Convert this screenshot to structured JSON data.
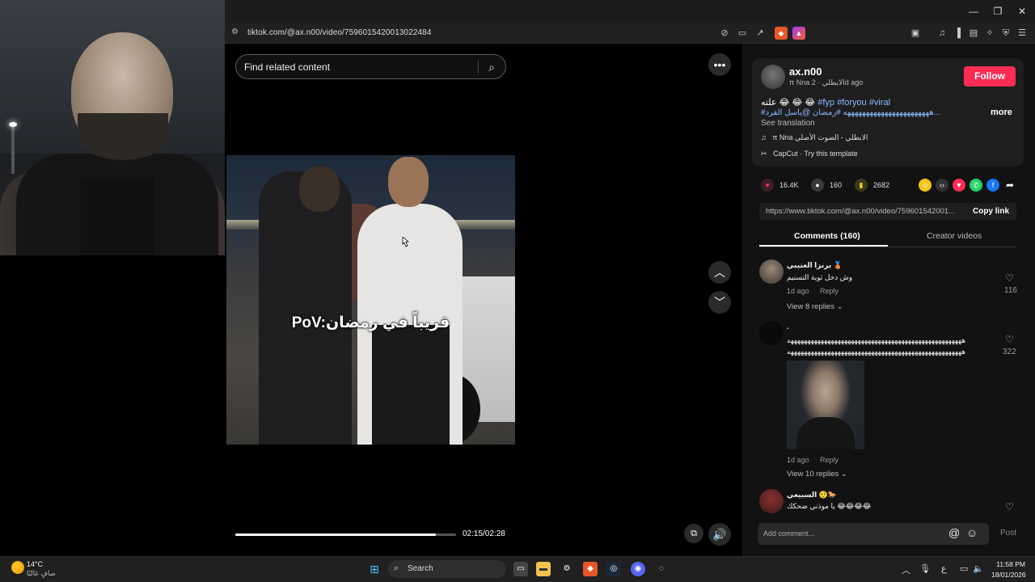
{
  "window": {
    "minimize": "—",
    "maximize": "❐",
    "close": "✕"
  },
  "address": {
    "url": "tiktok.com/@ax.n00/video/7596015420013022484"
  },
  "video": {
    "search_placeholder": "Find related content",
    "caption": "PoV:قريباً في رمضان",
    "time": "02:15/02:28",
    "progress_fraction": 0.91
  },
  "author": {
    "username": "ax.n00",
    "subtitle": "π Nna الابطلي · 2d ago",
    "follow_label": "Follow"
  },
  "description": {
    "prefix": "علته 😂 😂 😂",
    "tags": "#fyp #foryou #viral",
    "line2": "#هههههههههههههههههههههههه #رمضان @ياسل الفرد...",
    "more": "more",
    "see_translation": "See translation",
    "music": "π Nna الابطلي - الصوت الأصلي",
    "capcut": "CapCut · Try this template"
  },
  "stats": {
    "likes": "16.4K",
    "comments": "160",
    "saves": "2682"
  },
  "share": {
    "link": "https://www.tiktok.com/@ax.n00/video/759601542001...",
    "copy_label": "Copy link"
  },
  "tabs": {
    "comments": "Comments (160)",
    "creator": "Creator videos"
  },
  "comments": [
    {
      "name": "برنزا العتيبي 🥉",
      "text": "وش دخل ثوية التسنيم",
      "time": "1d ago",
      "reply": "Reply",
      "likes": "116",
      "replies": "View 8 replies ⌄"
    },
    {
      "name": ".",
      "text1": "ههههههههههههههههههههههههههههههههههههههههههههههههههههه",
      "text2": "ههههههههههههههههههههههههههههههههههههههههههههههههههههه",
      "time": "1d ago",
      "reply": "Reply",
      "likes": "322",
      "replies": "View 10 replies ⌄"
    },
    {
      "name": "السبيعي 🤨🐎",
      "text": "يا موذني ضحكك 😂😂😂😂"
    }
  ],
  "comment_input": {
    "placeholder": "Add comment...",
    "post": "Post"
  },
  "taskbar": {
    "temp": "14°C",
    "weather": "صافٍ غالبًا",
    "search": "Search",
    "lang": "ع",
    "time": "11:58 PM",
    "date": "18/01/2026"
  },
  "colors": {
    "follow": "#fe2c55",
    "hashtag": "#8eb8ff"
  }
}
